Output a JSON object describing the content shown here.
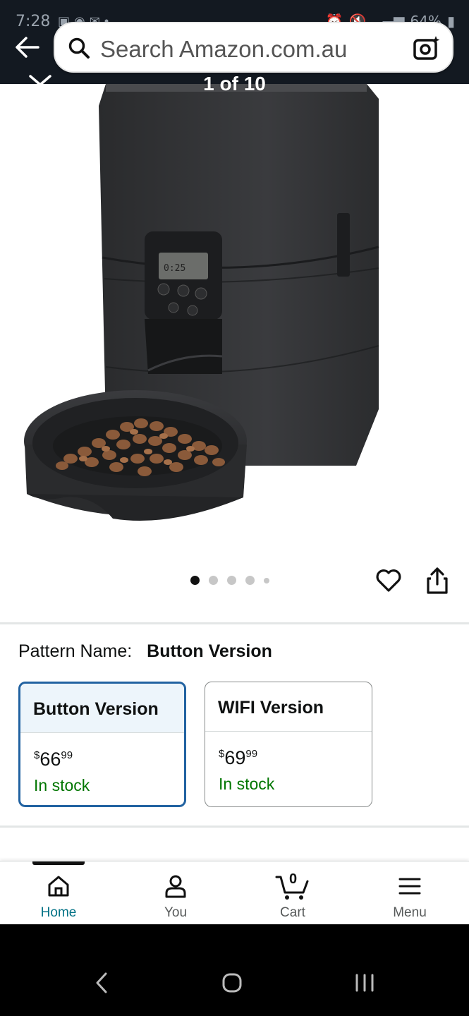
{
  "status_bar": {
    "time": "7:28",
    "battery": "64%"
  },
  "search": {
    "placeholder": "Search Amazon.com.au"
  },
  "product_image": {
    "counter": "1 of 10",
    "dots": 5,
    "active_dot": 1
  },
  "variation": {
    "label": "Pattern Name:",
    "selected_value": "Button Version",
    "options": [
      {
        "name": "Button Version",
        "price_currency": "$",
        "price_whole": "66",
        "price_fraction": "99",
        "stock": "In stock",
        "selected": true
      },
      {
        "name": "WIFI Version",
        "price_currency": "$",
        "price_whole": "69",
        "price_fraction": "99",
        "stock": "In stock",
        "selected": false
      }
    ]
  },
  "bottom_nav": {
    "items": [
      {
        "label": "Home",
        "icon": "home-icon",
        "active": true
      },
      {
        "label": "You",
        "icon": "person-icon",
        "active": false
      },
      {
        "label": "Cart",
        "icon": "cart-icon",
        "active": false,
        "count": "0"
      },
      {
        "label": "Menu",
        "icon": "menu-icon",
        "active": false
      }
    ]
  },
  "colors": {
    "header_bg": "#131921",
    "selected_border": "#2162a1",
    "in_stock": "#007600",
    "nav_active": "#007185"
  }
}
